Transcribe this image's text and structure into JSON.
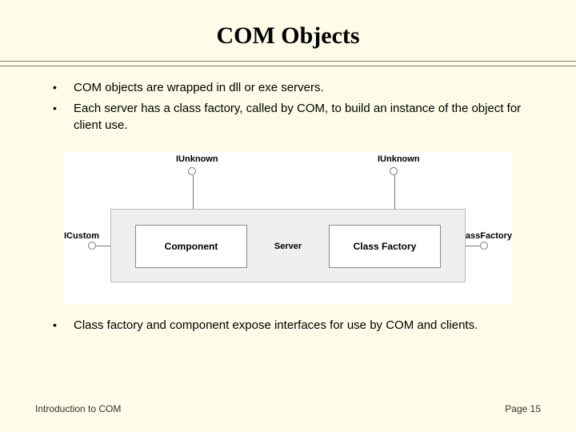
{
  "title": "COM Objects",
  "bullets_top": [
    "COM objects are wrapped in dll or exe servers.",
    "Each server has a class factory, called by COM, to build an instance of the object for client use."
  ],
  "bullets_bottom": [
    "Class factory and component expose interfaces for use by COM and clients."
  ],
  "diagram": {
    "iunknown_left": "IUnknown",
    "iunknown_right": "IUnknown",
    "icustom": "ICustom",
    "iclassfactory": "IClassFactory",
    "component": "Component",
    "server": "Server",
    "classfactory": "Class Factory"
  },
  "footer": {
    "left": "Introduction to COM",
    "right": "Page 15"
  }
}
